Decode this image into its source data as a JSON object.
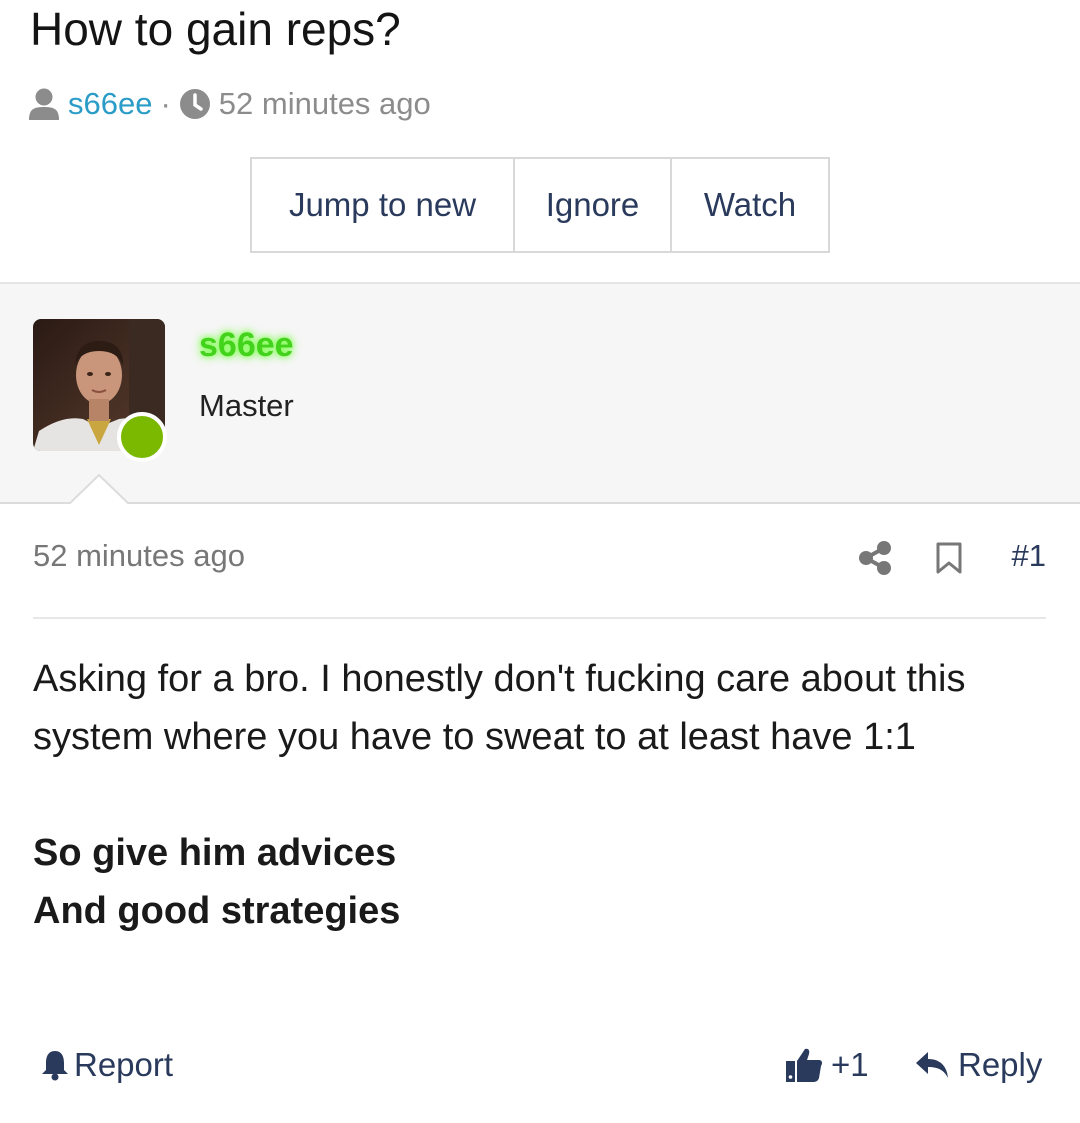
{
  "thread": {
    "title": "How to gain reps?",
    "author": "s66ee",
    "separator": "·",
    "time": "52 minutes ago"
  },
  "actions": {
    "jump_to_new": "Jump to new",
    "ignore": "Ignore",
    "watch": "Watch"
  },
  "post": {
    "username": "s66ee",
    "user_title": "Master",
    "date": "52 minutes ago",
    "number": "#1",
    "body_line1": "Asking for a bro. I honestly don't fucking care about this system where you have to sweat to at least have 1:1",
    "body_bold1": "So give him advices",
    "body_bold2": "And good strategies",
    "report": "Report",
    "like_count": "+1",
    "reply": "Reply"
  },
  "colors": {
    "link": "#2b9cc7",
    "accent": "#2a3a5c",
    "online": "#7bb800",
    "username_glow": "#44d31c"
  },
  "icons": [
    "user-icon",
    "clock-icon",
    "share-icon",
    "bookmark-icon",
    "bell-icon",
    "thumbs-up-icon",
    "reply-icon"
  ]
}
